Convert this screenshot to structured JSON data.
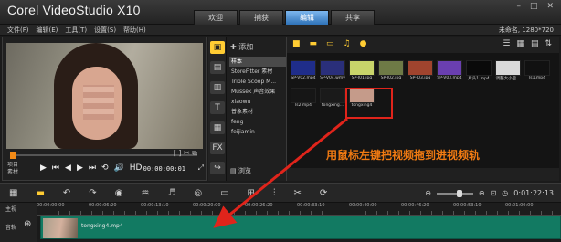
{
  "app": {
    "title": "Corel VideoStudio X10"
  },
  "tabs": [
    "欢迎",
    "捕获",
    "编辑",
    "共享"
  ],
  "active_tab": 2,
  "menu": [
    "文件(F)",
    "编辑(E)",
    "工具(T)",
    "设置(S)",
    "帮助(H)"
  ],
  "project_info": "未命名, 1280*720",
  "player": {
    "mode_labels": [
      "项目",
      "素材"
    ],
    "timecode": "00:00:00:01",
    "controls": [
      "▶",
      "⏮",
      "◀",
      "▶",
      "⏭",
      "⟲",
      "🔊",
      "HD"
    ]
  },
  "library": {
    "add_label": "添加",
    "folders": [
      "样本",
      "StoreFitter 素材",
      "Triple Scoop M...",
      "Mussek 声音效果",
      "xiaowu",
      "普象素材",
      "feng",
      "feijiamin"
    ],
    "selected_folder": 0,
    "browse_label": "浏览"
  },
  "media": {
    "row1": [
      "SP-V02.mp4",
      "SP-V04.wmv",
      "SP-I01.jpg",
      "SP-I02.jpg",
      "SP-I03.jpg",
      "SP-V03.mp4",
      "片头1.mp4",
      "调整大小后...",
      "ls1.mp4"
    ],
    "row2": [
      "ls2.mp4",
      "tongxing...",
      "tongxing4"
    ],
    "thumb_colors": [
      "#1f2d8a",
      "#2a2f7a",
      "#c8d46a",
      "#6e7a46",
      "#a0442e",
      "#6a3fb0",
      "#0a0a0a",
      "#d9d9d9",
      "#111111",
      "#161616",
      "#1a1a1a",
      "#c59b8a"
    ]
  },
  "hint_text": "用鼠标左键把视频拖到进视频轨",
  "timeline": {
    "timecode": "0:01:22:13",
    "ruler_marks": [
      "00:00:00:00",
      "00:00:06:20",
      "00:00:13:10",
      "00:00:20:00",
      "00:00:26:20",
      "00:00:33:10",
      "00:00:40:00",
      "00:00:46:20",
      "00:00:53:10",
      "00:01:00:00"
    ],
    "track_labels": [
      "主视",
      "音轨"
    ],
    "clip_name": "tongxing4.mp4"
  },
  "colors": {
    "accent": "#f28a16",
    "tab_active": "#2f73b8",
    "clip": "#127a62",
    "highlight": "#e0241b"
  }
}
